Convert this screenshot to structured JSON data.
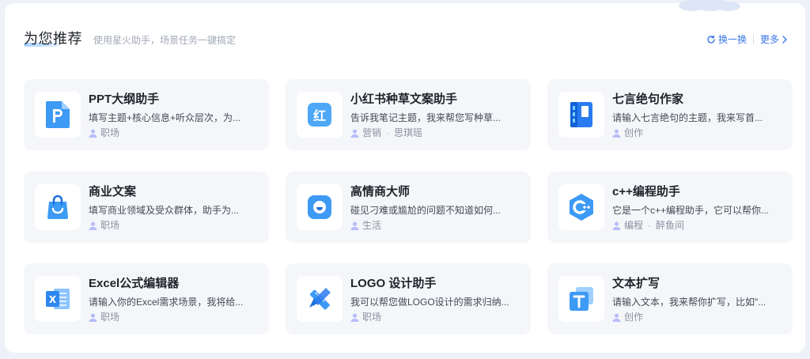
{
  "section": {
    "title": "为您推荐",
    "subtitle": "使用星火助手，场景任务一键搞定",
    "refresh_label": "换一换",
    "more_label": "更多"
  },
  "assistants": [
    {
      "name": "PPT大纲助手",
      "desc": "填写主题+核心信息+听众层次，为...",
      "category": "职场",
      "author": "",
      "icon": "ppt-icon",
      "color": "#3d8bf5"
    },
    {
      "name": "小红书种草文案助手",
      "desc": "告诉我笔记主题，我来帮您写种草...",
      "category": "营销",
      "author": "思琪瑶",
      "icon": "red-book-icon",
      "color": "#3d8bf5"
    },
    {
      "name": "七言绝句作家",
      "desc": "请输入七言绝句的主题，我来写首...",
      "category": "创作",
      "author": "",
      "icon": "poem-book-icon",
      "color": "#2b7bf0"
    },
    {
      "name": "商业文案",
      "desc": "填写商业领域及受众群体，助手为...",
      "category": "职场",
      "author": "",
      "icon": "shopping-bag-icon",
      "color": "#3d8bf5"
    },
    {
      "name": "高情商大师",
      "desc": "碰见刁难或尴尬的问题不知道如何...",
      "category": "生活",
      "author": "",
      "icon": "smile-face-icon",
      "color": "#3d8bf5"
    },
    {
      "name": "c++编程助手",
      "desc": "它是一个c++编程助手，它可以帮你...",
      "category": "编程",
      "author": "醉鱼间",
      "icon": "cpp-icon",
      "color": "#3d8bf5"
    },
    {
      "name": "Excel公式编辑器",
      "desc": "请输入你的Excel需求场景，我将给...",
      "category": "职场",
      "author": "",
      "icon": "excel-icon",
      "color": "#3d8bf5"
    },
    {
      "name": "LOGO 设计助手",
      "desc": "我可以帮您做LOGO设计的需求归纳...",
      "category": "职场",
      "author": "",
      "icon": "design-ruler-icon",
      "color": "#3d8bf5"
    },
    {
      "name": "文本扩写",
      "desc": "请输入文本，我来帮你扩写，比如\"...",
      "category": "创作",
      "author": "",
      "icon": "text-t-icon",
      "color": "#3d8bf5"
    }
  ]
}
